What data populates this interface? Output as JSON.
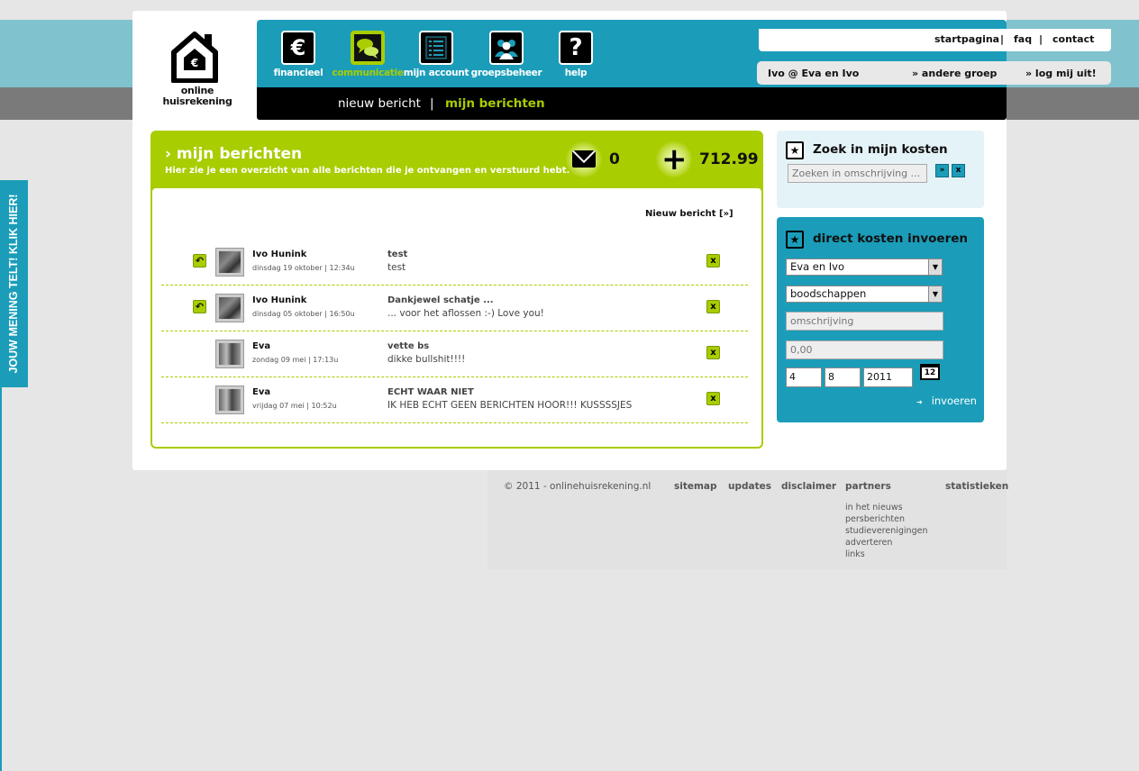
{
  "logo": {
    "line1": "online",
    "line2": "huisrekening"
  },
  "nav": [
    {
      "label": "financieel",
      "icon": "euro-icon",
      "glyph": "€"
    },
    {
      "label": "communicatie",
      "icon": "speech-bubbles-icon",
      "glyph": ""
    },
    {
      "label": "mijn account",
      "icon": "account-list-icon",
      "glyph": ""
    },
    {
      "label": "groepsbeheer",
      "icon": "group-icon",
      "glyph": ""
    },
    {
      "label": "help",
      "icon": "question-icon",
      "glyph": "?"
    }
  ],
  "toplinks": {
    "home": "startpagina",
    "faq": "faq",
    "contact": "contact",
    "sep": "|"
  },
  "userbar": {
    "user": "Ivo @ Eva en Ivo",
    "switch_group": "» andere groep",
    "logout": "» log mij uit!"
  },
  "subnav": {
    "new": "nieuw bericht",
    "sep": "|",
    "mine": "mijn berichten"
  },
  "main": {
    "title": "› mijn berichten",
    "subtitle": "Hier zie je een overzicht van alle berichten die je ontvangen en verstuurd hebt.",
    "message_count": "0",
    "balance": "712.99",
    "new_link": "Nieuw bericht [»]"
  },
  "messages": [
    {
      "sender": "Ivo Hunink",
      "date": "dinsdag 19 oktober | 12:34u",
      "subject": "test",
      "preview": "test",
      "reply": true
    },
    {
      "sender": "Ivo Hunink",
      "date": "dinsdag 05 oktober | 16:50u",
      "subject": "Dankjewel schatje ...",
      "preview": "... voor het aflossen :-) Love you!",
      "reply": true
    },
    {
      "sender": "Eva",
      "date": "zondag 09 mei | 17:13u",
      "subject": "vette bs",
      "preview": "dikke bullshit!!!!",
      "reply": false
    },
    {
      "sender": "Eva",
      "date": "vrijdag 07 mei | 10:52u",
      "subject": "ECHT WAAR NIET",
      "preview": "IK HEB ECHT GEEN BERICHTEN HOOR!!! KUSSSSJES",
      "reply": false
    }
  ],
  "search_box": {
    "title": "Zoek in mijn kosten",
    "placeholder": "Zoeken in omschrijving ...",
    "go": "»",
    "clear": "x"
  },
  "cost_box": {
    "title": "direct kosten invoeren",
    "group": "Eva en Ivo",
    "category": "boodschappen",
    "description_placeholder": "omschrijving",
    "amount_placeholder": "0,00",
    "day": "4",
    "month": "8",
    "year": "2011",
    "calendar_label": "12",
    "submit": "invoeren"
  },
  "footer": {
    "copyright": "© 2011 - onlinehuisrekening.nl",
    "links": [
      "sitemap",
      "updates",
      "disclaimer",
      "partners",
      "statistieken"
    ],
    "partners": [
      "in het nieuws",
      "persberichten",
      "studieverenigingen",
      "adverteren",
      "links"
    ]
  },
  "sidetab": "JOUW MENING TELT! KLIK HIER!",
  "colors": {
    "teal": "#1b9db9",
    "lime": "#a8cd00",
    "black": "#000000"
  }
}
